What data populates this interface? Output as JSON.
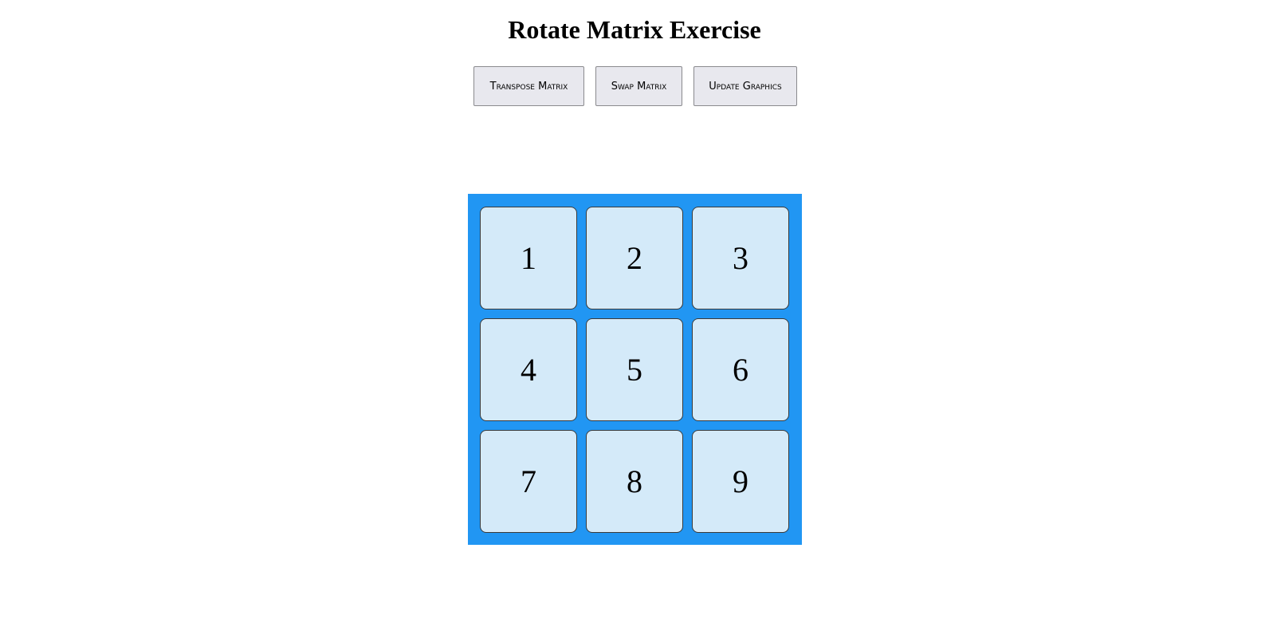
{
  "page": {
    "title": "Rotate Matrix Exercise"
  },
  "toolbar": {
    "transpose_label": "Transpose Matrix",
    "swap_label": "Swap Matrix",
    "update_label": "Update Graphics"
  },
  "matrix": {
    "rows": [
      [
        "1",
        "2",
        "3"
      ],
      [
        "4",
        "5",
        "6"
      ],
      [
        "7",
        "8",
        "9"
      ]
    ]
  },
  "colors": {
    "board_background": "#2196f3",
    "cell_background": "#d4eaf9",
    "button_background": "#e8e8ee"
  }
}
